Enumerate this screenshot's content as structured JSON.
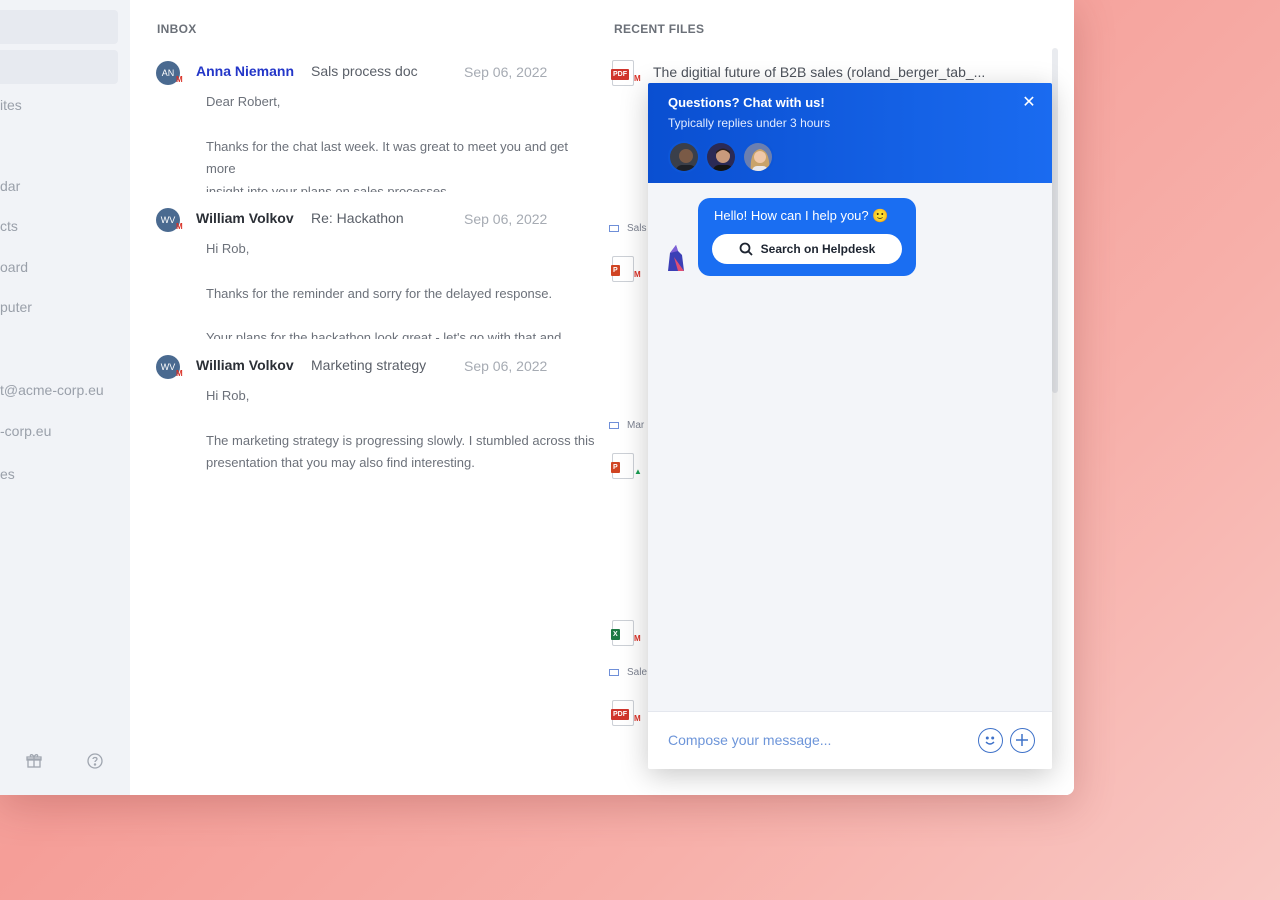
{
  "sidebar": {
    "items": [
      {
        "label": "ites"
      },
      {
        "label": "dar"
      },
      {
        "label": "cts"
      },
      {
        "label": "oard"
      },
      {
        "label": "puter"
      },
      {
        "label": "t@acme-corp.eu"
      },
      {
        "label": "-corp.eu"
      },
      {
        "label": "es"
      }
    ],
    "bottom_icons": [
      "gift-icon",
      "help-icon"
    ]
  },
  "inbox": {
    "title": "INBOX",
    "emails": [
      {
        "initials": "AN",
        "sender": "Anna Niemann",
        "subject": "Sals process doc",
        "date": "Sep 06, 2022",
        "line1": "Dear Robert,",
        "line2": "Thanks for the chat last week. It was great to meet you and get more",
        "line3": "insight into your plans on sales processes."
      },
      {
        "initials": "WV",
        "sender": "William Volkov",
        "subject": "Re: Hackathon",
        "date": "Sep 06, 2022",
        "line1": "Hi Rob,",
        "line2": "Thanks for the reminder and sorry for the delayed response.",
        "line3": "Your plans for the hackathon look great - let's go with that and"
      },
      {
        "initials": "WV",
        "sender": "William Volkov",
        "subject": "Marketing strategy",
        "date": "Sep 06, 2022",
        "line1": "Hi Rob,",
        "line2": "The marketing strategy is progressing slowly. I stumbled across this",
        "line3": "presentation that you may also find interesting."
      }
    ]
  },
  "files": {
    "title": "RECENT FILES",
    "first_file_name": "The digitial future of B2B sales (roland_berger_tab_...",
    "meta": [
      "Sals",
      "Mar",
      "Sale"
    ],
    "icons": [
      "pdf-file-icon",
      "powerpoint-file-icon",
      "powerpoint-drive-file-icon",
      "excel-file-icon",
      "pdf-file-icon"
    ]
  },
  "chat": {
    "title": "Questions? Chat with us!",
    "subtitle": "Typically replies under 3 hours",
    "greeting": "Hello! How can I help you? 🙂",
    "helpdesk_button": "Search on Helpdesk",
    "compose_placeholder": "Compose your message...",
    "accent_color": "#1a6ef2",
    "header_color": "#0a4fd1"
  },
  "colors": {
    "background": "#f59e98",
    "unread_sender": "#2336c8"
  }
}
